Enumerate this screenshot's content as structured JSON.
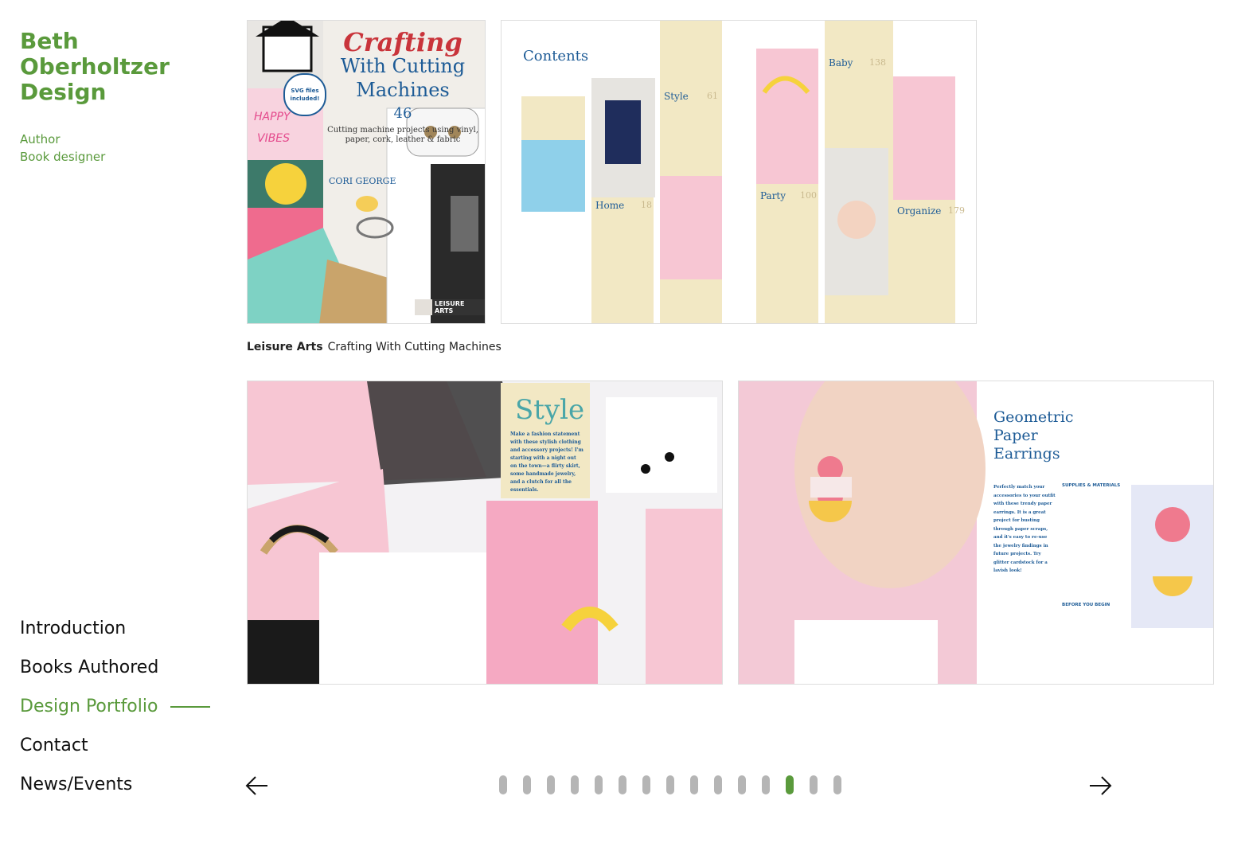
{
  "site": {
    "brand_line1": "Beth",
    "brand_line2": "Oberholtzer",
    "brand_line3": "Design",
    "role1": "Author",
    "role2": "Book designer"
  },
  "nav": {
    "items": [
      {
        "label": "Introduction"
      },
      {
        "label": "Books Authored"
      },
      {
        "label": "Design Portfolio"
      },
      {
        "label": "Contact"
      },
      {
        "label": "News/Events"
      }
    ],
    "active_index": 2
  },
  "caption": {
    "publisher": "Leisure Arts",
    "title": "Crafting With Cutting Machines"
  },
  "cover": {
    "title_line1": "Crafting",
    "title_line2": "With Cutting",
    "title_line3": "Machines",
    "number": "46",
    "subtitle": "Cutting machine projects using vinyl, paper, cork, leather & fabric",
    "badge": "SVG files included!",
    "author": "CORI GEORGE",
    "publisher_logo": "LEISURE ARTS"
  },
  "toc": {
    "heading": "Contents",
    "sections": [
      {
        "name": "Home",
        "page": "18"
      },
      {
        "name": "Style",
        "page": "61"
      },
      {
        "name": "Party",
        "page": "100"
      },
      {
        "name": "Baby",
        "page": "138"
      },
      {
        "name": "Organize",
        "page": "179"
      }
    ]
  },
  "style_spread": {
    "heading": "Style",
    "body": "Make a fashion statement with these stylish clothing and accessory projects! I'm starting with a night out on the town—a flirty skirt, some handmade jewelry, and a clutch for all the essentials."
  },
  "earrings_spread": {
    "heading_line1": "Geometric",
    "heading_line2": "Paper",
    "heading_line3": "Earrings",
    "intro": "Perfectly match your accessories to your outfit with these trendy paper earrings. It is a great project for busting through paper scraps, and it's easy to re-use the jewelry findings in future projects. Try glitter cardstock for a lavish look!",
    "supplies_heading": "SUPPLIES & MATERIALS",
    "before_heading": "BEFORE YOU BEGIN"
  },
  "pager": {
    "total": 15,
    "active": 12
  },
  "colors": {
    "accent": "#5a9a3c",
    "dot_inactive": "#b5b5b5",
    "toc_band": "#f2e8c4",
    "book_blue": "#1d5b96",
    "book_red": "#c9343b",
    "pink": "#f7c6d3"
  },
  "icons": {
    "prev": "arrow-left-icon",
    "next": "arrow-right-icon"
  }
}
